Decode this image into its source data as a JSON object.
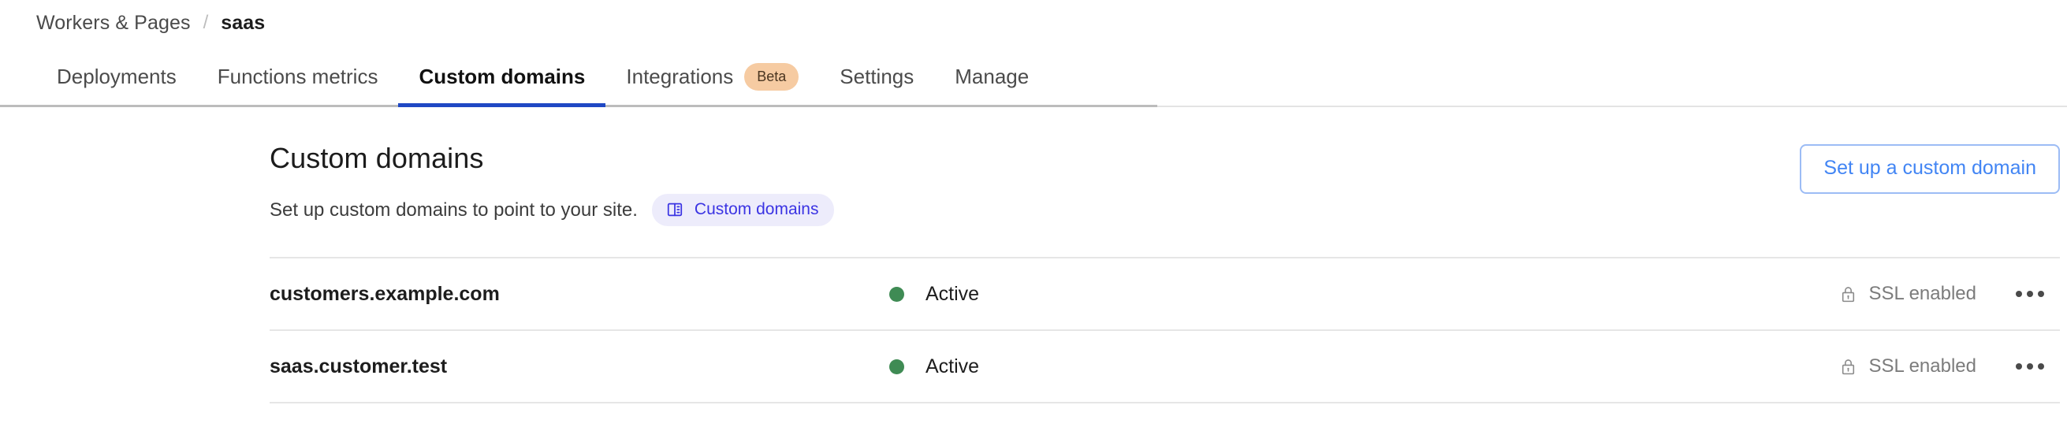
{
  "breadcrumb": {
    "parent": "Workers & Pages",
    "separator": "/",
    "current": "saas"
  },
  "tabs": [
    {
      "label": "Deployments",
      "active": false
    },
    {
      "label": "Functions metrics",
      "active": false
    },
    {
      "label": "Custom domains",
      "active": true
    },
    {
      "label": "Integrations",
      "active": false,
      "badge": "Beta"
    },
    {
      "label": "Settings",
      "active": false
    },
    {
      "label": "Manage",
      "active": false
    }
  ],
  "section": {
    "title": "Custom domains",
    "subtitle": "Set up custom domains to point to your site.",
    "doc_link": "Custom domains",
    "doc_icon": "book-icon",
    "primary_button": "Set up a custom domain"
  },
  "domains": [
    {
      "name": "customers.example.com",
      "status": "Active",
      "status_dot": "#3f8b54",
      "ssl": "SSL enabled",
      "ssl_icon": "lock-icon",
      "menu_icon": "overflow-menu-icon"
    },
    {
      "name": "saas.customer.test",
      "status": "Active",
      "status_dot": "#3f8b54",
      "ssl": "SSL enabled",
      "ssl_icon": "lock-icon",
      "menu_icon": "overflow-menu-icon"
    }
  ],
  "colors": {
    "active_tab_underline": "#1f48c4",
    "doc_pill_bg": "#edecfb",
    "doc_pill_text": "#3b34e3",
    "beta_badge_bg": "#f6cba2",
    "beta_badge_text": "#4a3520",
    "button_border": "#9cbcf5",
    "button_text": "#4285f4",
    "status_green": "#3f8b54"
  }
}
